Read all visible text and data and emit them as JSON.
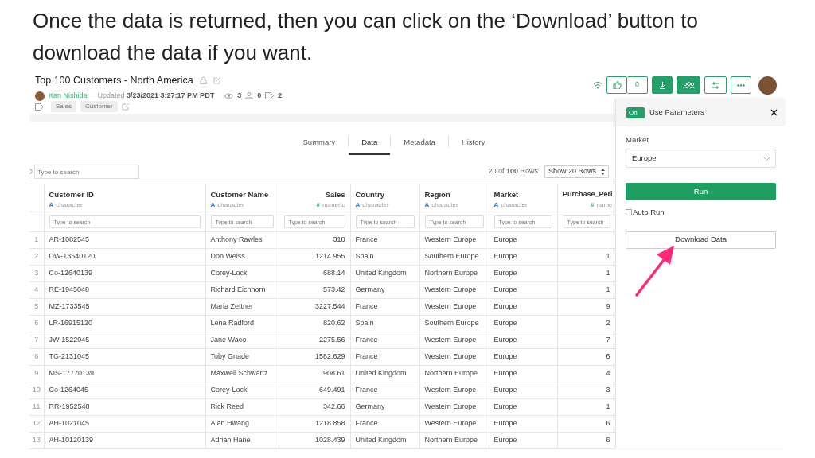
{
  "caption": "Once the data is returned, then you can click on the ‘Download’ button to download the data if you want.",
  "report": {
    "title": "Top 100 Customers - North America",
    "author": "Kan Nishida",
    "updated_label": "Updated",
    "updated_time": "3/23/2021 3:27:17 PM PDT",
    "views": "3",
    "forks": "0",
    "tag_count": "2",
    "tags": [
      "Sales",
      "Customer"
    ]
  },
  "toolbar": {
    "likes": "0"
  },
  "tabs": [
    {
      "label": "Summary",
      "selected": false
    },
    {
      "label": "Data",
      "selected": true
    },
    {
      "label": "Metadata",
      "selected": false
    },
    {
      "label": "History",
      "selected": false
    }
  ],
  "search": {
    "placeholder": "Type to search"
  },
  "row_count": "20 of **100** Rows",
  "page_size": "Show 20 Rows",
  "table": {
    "columns": [
      {
        "name": "Customer ID",
        "type_icon": "A",
        "type": "character",
        "kind": "character",
        "placeholder": "Type to search"
      },
      {
        "name": "Customer Name",
        "type_icon": "A",
        "type": "character",
        "kind": "character",
        "placeholder": "Type to search"
      },
      {
        "name": "Sales",
        "type_icon": "#",
        "type": "numeric",
        "kind": "numeric",
        "placeholder": "Type to search"
      },
      {
        "name": "Country",
        "type_icon": "A",
        "type": "character",
        "kind": "character",
        "placeholder": "Type to search"
      },
      {
        "name": "Region",
        "type_icon": "A",
        "type": "character",
        "kind": "character",
        "placeholder": "Type to search"
      },
      {
        "name": "Market",
        "type_icon": "A",
        "type": "character",
        "kind": "character",
        "placeholder": "Type to search"
      },
      {
        "name": "Purchase_Peri",
        "type_icon": "#",
        "type": "nume",
        "kind": "numeric",
        "placeholder": "Type to search"
      }
    ],
    "rows": [
      {
        "index": "1",
        "cells": [
          "AR-1082545",
          "Anthony Rawles",
          "318",
          "France",
          "Western Europe",
          "Europe"
        ]
      },
      {
        "index": "2",
        "cells": [
          "DW-13540120",
          "Don Weiss",
          "1214.955",
          "Spain",
          "Southern Europe",
          "Europe",
          "1"
        ]
      },
      {
        "index": "3",
        "cells": [
          "Co-12640139",
          "Corey-Lock",
          "688.14",
          "United Kingdom",
          "Northern Europe",
          "Europe",
          "1"
        ]
      },
      {
        "index": "4",
        "cells": [
          "RE-1945048",
          "Richard Eichhorn",
          "573.42",
          "Germany",
          "Western Europe",
          "Europe",
          "1"
        ]
      },
      {
        "index": "5",
        "cells": [
          "MZ-1733545",
          "Maria Zettner",
          "3227.544",
          "France",
          "Western Europe",
          "Europe",
          "9"
        ]
      },
      {
        "index": "6",
        "cells": [
          "LR-16915120",
          "Lena Radford",
          "820.62",
          "Spain",
          "Southern Europe",
          "Europe",
          "2"
        ]
      },
      {
        "index": "7",
        "cells": [
          "JW-1522045",
          "Jane Waco",
          "2275.56",
          "France",
          "Western Europe",
          "Europe",
          "7"
        ]
      },
      {
        "index": "8",
        "cells": [
          "TG-2131045",
          "Toby Gnade",
          "1582.629",
          "France",
          "Western Europe",
          "Europe",
          "6"
        ]
      },
      {
        "index": "9",
        "cells": [
          "MS-17770139",
          "Maxwell Schwartz",
          "908.61",
          "United Kingdom",
          "Northern Europe",
          "Europe",
          "4"
        ]
      },
      {
        "index": "10",
        "cells": [
          "Co-1264045",
          "Corey-Lock",
          "649.491",
          "France",
          "Western Europe",
          "Europe",
          "3"
        ]
      },
      {
        "index": "11",
        "cells": [
          "RR-1952548",
          "Rick Reed",
          "342.66",
          "Germany",
          "Western Europe",
          "Europe",
          "1"
        ]
      },
      {
        "index": "12",
        "cells": [
          "AH-1021045",
          "Alan Hwang",
          "1218.858",
          "France",
          "Western Europe",
          "Europe",
          "6"
        ]
      },
      {
        "index": "13",
        "cells": [
          "AH-10120139",
          "Adrian Hane",
          "1028.439",
          "United Kingdom",
          "Northern Europe",
          "Europe",
          "6"
        ]
      }
    ]
  },
  "panel": {
    "toggle": {
      "label": "On",
      "on": true
    },
    "title": "Use Parameters",
    "field_label": "Market",
    "value": "Europe",
    "run": "Run",
    "auto_run": {
      "label": "Auto Run",
      "checked": false
    },
    "download": "Download Data"
  }
}
